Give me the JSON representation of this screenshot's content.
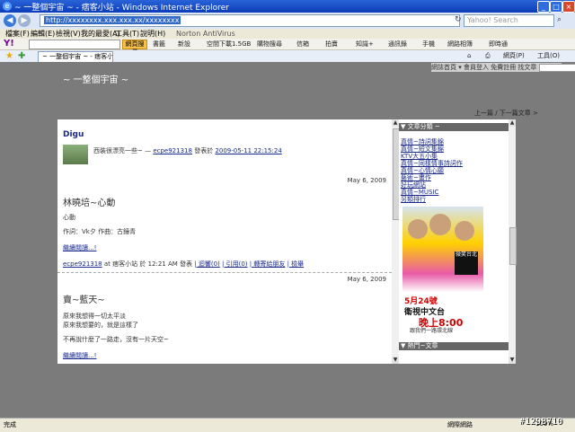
{
  "window": {
    "title": "~ 一整個宇宙 ~ - 痞客小站 - Windows Internet Explorer",
    "minimize": "_",
    "maximize": "□",
    "close": "×"
  },
  "address": {
    "url": "http://xxxxxxxx.xxx.xxx.xx/xxxxxxxx",
    "search_placeholder": "Yahoo! Search"
  },
  "menu": [
    "檔案(F)",
    "編輯(E)",
    "檢視(V)",
    "我的最愛(A)",
    "工具(T)",
    "說明(H)"
  ],
  "menu_extra": "Norton AntiVirus",
  "yahoo": {
    "logo": "Y!",
    "search_button": "網頁搜尋",
    "tools": [
      "書籤",
      "新設",
      "空間下載1.5GB",
      "購物搜尋",
      "信箱",
      "拍賣",
      "知識+",
      "通訊錄",
      "手機",
      "網路相簿",
      "即時通"
    ]
  },
  "tab": {
    "label": "~ 一整個宇宙 ~ - 痞客小站"
  },
  "right_tools": [
    "網頁(P)",
    "工具(O)"
  ],
  "page": {
    "blog_search": "網誌首頁 ▾   會員登入   免費註冊   找文章",
    "blog_title": "~ 一整個宇宙 ~",
    "nav": "上一篇 / 下一篇文章 >"
  },
  "post_header": {
    "author": "Digu",
    "comment_prefix": "西裝很漂亮一些~ — ",
    "comment_user": "ecpe921318",
    "comment_mid": " 發表於 ",
    "comment_time": "2009-05-11 22:15:24"
  },
  "posts": [
    {
      "date": "May 6, 2009",
      "title": "林曉培~心動",
      "body1": "心動",
      "body2": "作詞：Vk夕   作曲：古鐘青",
      "more": "繼續閱讀...!",
      "footer_user": "ecpe921318",
      "footer_rest": " at 痞客小站 於 12:21 AM 發表",
      "footer_links": [
        "| 迴響(0)",
        "| 引用(0)",
        "| 轉寄給朋友",
        "| 檢舉"
      ]
    },
    {
      "date": "May 6, 2009",
      "title": "賣~藍天~",
      "body1": "原來我想得一切太平淡",
      "body2": "原來我想要的，就是這樣了",
      "body3": "不再說什麼了一路走，沒有一片天空~",
      "more": "繼續閱讀...!"
    }
  ],
  "sidebar": {
    "header1": "▼ 文章分類 ~",
    "links": [
      "真情~詩詞集錦",
      "真情~短文集錦",
      "KTV大五小集",
      "真情~同樣情事詩詞作",
      "真情~心情心願",
      "藝術~畫作",
      "好玩網站",
      "真情~MUSIC",
      "另類排行"
    ],
    "header2": "▼ 熱門~文章"
  },
  "ad": {
    "date": "5月24號",
    "channel": "衛視中文台",
    "time": "晚上8:00",
    "slogan": "跟我們一路環北線",
    "badge": "微笑台北"
  },
  "status": {
    "text": "完成",
    "zone": "網際網路",
    "zoom": "100%"
  },
  "watermark": "#1298710"
}
